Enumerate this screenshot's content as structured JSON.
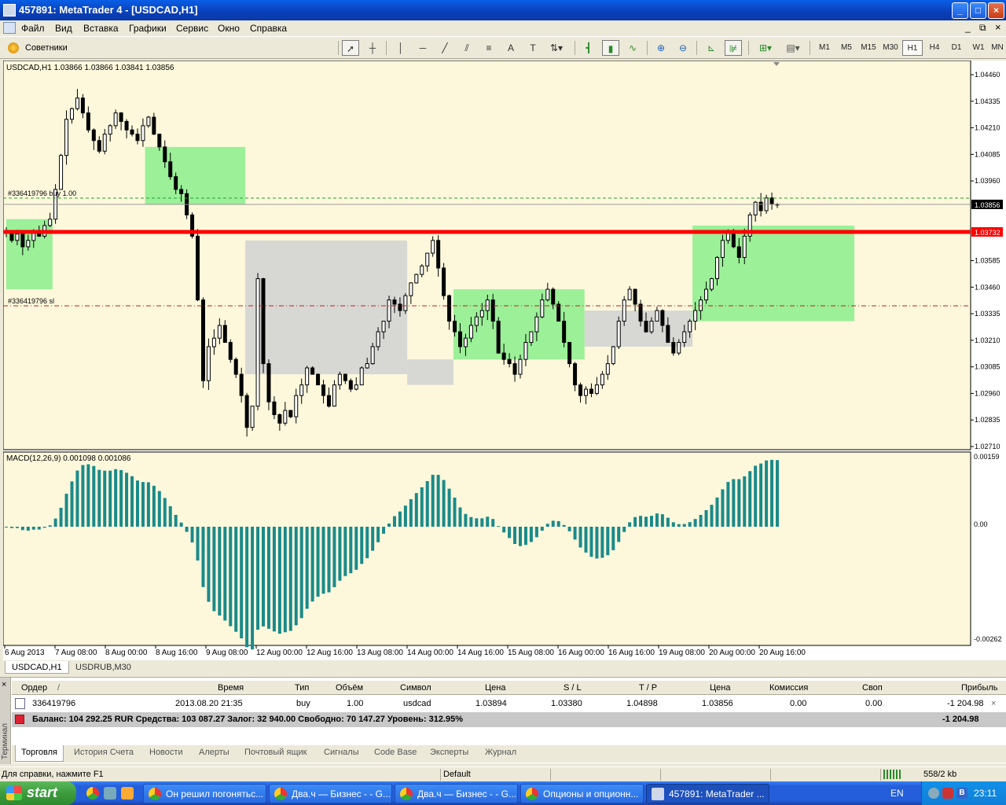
{
  "window": {
    "title": "457891: MetaTrader 4 - [USDCAD,H1]",
    "buttons": [
      "_",
      "□",
      "×"
    ],
    "child_buttons": [
      "_",
      "⧉",
      "×"
    ]
  },
  "menu": [
    "Файл",
    "Вид",
    "Вставка",
    "Графики",
    "Сервис",
    "Окно",
    "Справка"
  ],
  "toolbar": {
    "advisors_label": "Советники",
    "tools": [
      "cursor-icon",
      "crosshair-icon",
      "vertical-line-icon",
      "horizontal-line-icon",
      "trendline-icon",
      "equidistant-channel-icon",
      "fibonacci-icon",
      "text-icon",
      "text-label-icon",
      "arrows-icon",
      "bar-chart-icon",
      "candlestick-icon",
      "line-chart-icon",
      "zoom-in-icon",
      "zoom-out-icon",
      "autoscroll-icon",
      "chart-shift-icon",
      "indicators-icon",
      "periods-icon"
    ],
    "timeframes": [
      "M1",
      "M5",
      "M15",
      "M30",
      "H1",
      "H4",
      "D1",
      "W1",
      "MN"
    ],
    "selected_timeframe": "H1"
  },
  "chart": {
    "header": "USDCAD,H1  1.03866 1.03866 1.03841 1.03856",
    "price_axis": [
      "1.04460",
      "1.04335",
      "1.04210",
      "1.04085",
      "1.03960",
      "1.03856",
      "1.03732",
      "1.03585",
      "1.03460",
      "1.03335",
      "1.03210",
      "1.03085",
      "1.02960",
      "1.02835",
      "1.02710"
    ],
    "current_price": "1.03856",
    "line_price": "1.03732",
    "order_label": "#336419796 buy 1.00",
    "sl_label": "#336419796 sl",
    "time_axis": [
      "6 Aug 2013",
      "7 Aug 08:00",
      "8 Aug 00:00",
      "8 Aug 16:00",
      "9 Aug 08:00",
      "12 Aug 00:00",
      "12 Aug 16:00",
      "13 Aug 08:00",
      "14 Aug 00:00",
      "14 Aug 16:00",
      "15 Aug 08:00",
      "16 Aug 00:00",
      "16 Aug 16:00",
      "19 Aug 08:00",
      "20 Aug 00:00",
      "20 Aug 16:00"
    ],
    "macd_header": "MACD(12,26,9) 0.001098 0.001086",
    "macd_axis": [
      "0.00159",
      "0.00",
      "-0.00262"
    ],
    "colors": {
      "background": "#fdf8dc",
      "candles": "#000000",
      "kumo_bull": "#90ee90",
      "kumo_bear": "#d3d3d3",
      "macd": "#1a8a8a",
      "red_line": "#ff0000"
    }
  },
  "chart_data": {
    "type": "candlestick",
    "symbol": "USDCAD",
    "timeframe": "H1",
    "ylim": [
      1.0271,
      1.0446
    ],
    "close_approx": [
      1.0372,
      1.0368,
      1.0371,
      1.0365,
      1.0368,
      1.0372,
      1.037,
      1.0375,
      1.0378,
      1.0392,
      1.0408,
      1.0425,
      1.043,
      1.0435,
      1.0428,
      1.042,
      1.0415,
      1.041,
      1.0418,
      1.0422,
      1.0428,
      1.0424,
      1.042,
      1.0418,
      1.0415,
      1.0422,
      1.0426,
      1.0418,
      1.0412,
      1.0405,
      1.0398,
      1.0392,
      1.039,
      1.038,
      1.037,
      1.034,
      1.0302,
      1.0318,
      1.0322,
      1.0328,
      1.032,
      1.0312,
      1.0305,
      1.0295,
      1.028,
      1.029,
      1.035,
      1.031,
      1.0292,
      1.0286,
      1.0282,
      1.0288,
      1.0285,
      1.0295,
      1.03,
      1.0308,
      1.0305,
      1.03,
      1.0295,
      1.029,
      1.03,
      1.0305,
      1.0302,
      1.0298,
      1.03,
      1.0308,
      1.031,
      1.0318,
      1.0325,
      1.033,
      1.034,
      1.0338,
      1.0335,
      1.0342,
      1.0348,
      1.0352,
      1.0356,
      1.0362,
      1.0368,
      1.0355,
      1.0342,
      1.033,
      1.0325,
      1.0318,
      1.0322,
      1.0328,
      1.0332,
      1.0335,
      1.034,
      1.033,
      1.0315,
      1.0312,
      1.031,
      1.0305,
      1.0312,
      1.032,
      1.0325,
      1.0332,
      1.034,
      1.0345,
      1.0338,
      1.033,
      1.032,
      1.031,
      1.03,
      1.0295,
      1.0298,
      1.0296,
      1.03,
      1.0305,
      1.031,
      1.0318,
      1.033,
      1.034,
      1.0345,
      1.0338,
      1.033,
      1.0325,
      1.033,
      1.0335,
      1.0328,
      1.032,
      1.0315,
      1.032,
      1.0325,
      1.033,
      1.0335,
      1.034,
      1.0345,
      1.035,
      1.036,
      1.0368,
      1.0372,
      1.0365,
      1.036,
      1.037,
      1.038,
      1.0386,
      1.0382,
      1.0388,
      1.0385,
      1.0385
    ]
  },
  "chart_tabs": [
    "USDCAD,H1",
    "USDRUB,M30"
  ],
  "terminal": {
    "side_label": "Терминал",
    "columns": [
      "Ордер",
      "/",
      "Время",
      "Тип",
      "Объём",
      "Символ",
      "Цена",
      "S / L",
      "T / P",
      "Цена",
      "Комиссия",
      "Своп",
      "Прибыль"
    ],
    "order": {
      "ticket": "336419796",
      "time": "2013.08.20 21:35",
      "type": "buy",
      "volume": "1.00",
      "symbol": "usdcad",
      "open_price": "1.03894",
      "sl": "1.03380",
      "tp": "1.04898",
      "price": "1.03856",
      "commission": "0.00",
      "swap": "0.00",
      "profit": "-1 204.98",
      "close": "×"
    },
    "balance_line": "Баланс: 104 292.25 RUR  Средства: 103 087.27  Залог: 32 940.00  Свободно: 70 147.27  Уровень: 312.95%",
    "balance_profit": "-1 204.98",
    "tabs": [
      "Торговля",
      "История Счета",
      "Новости",
      "Алерты",
      "Почтовый ящик",
      "Сигналы",
      "Code Base",
      "Эксперты",
      "Журнал"
    ]
  },
  "status": {
    "help": "Для справки, нажмите F1",
    "profile": "Default",
    "traffic": "558/2 kb"
  },
  "taskbar": {
    "start": "start",
    "tasks": [
      "Он решил погонятьс...",
      "Два.ч — Бизнес - - G...",
      "Два.ч — Бизнес - - G...",
      "Опционы и опционн...",
      "457891: MetaTrader ..."
    ],
    "lang": "EN",
    "clock": "23:11"
  }
}
